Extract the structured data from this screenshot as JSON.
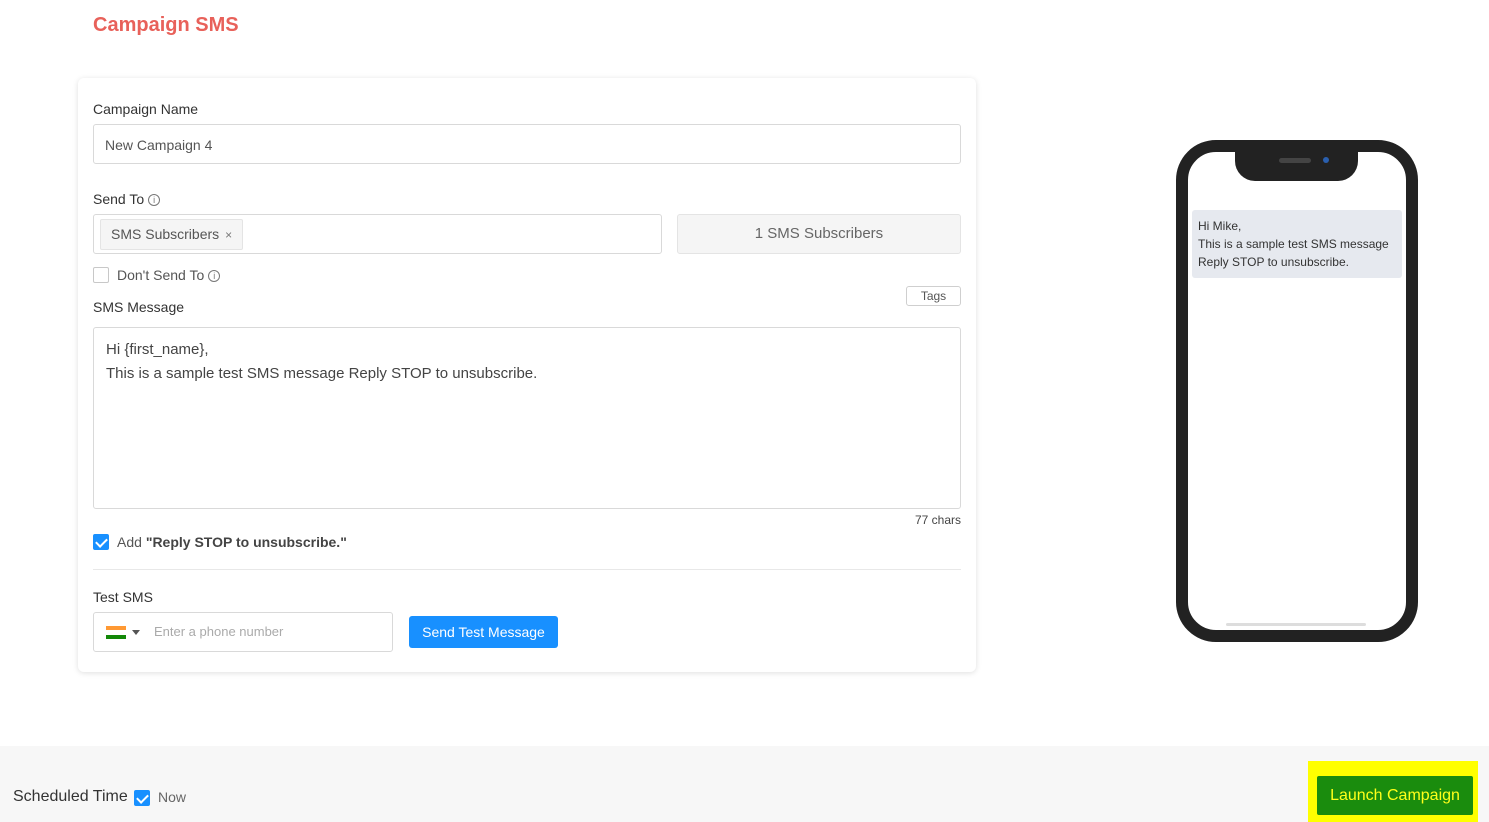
{
  "page": {
    "title": "Campaign SMS"
  },
  "form": {
    "campaign_name_label": "Campaign Name",
    "campaign_name_value": "New Campaign 4",
    "send_to_label": "Send To",
    "send_to_chip": "SMS Subscribers",
    "send_to_chip_remove": "×",
    "subscriber_count": "1 SMS Subscribers",
    "dont_send_to_label": "Don't Send To",
    "sms_message_label": "SMS Message",
    "tags_button": "Tags",
    "sms_message_line1": "Hi {first_name},",
    "sms_message_line2": "This is a sample test SMS message Reply STOP to unsubscribe.",
    "char_count": "77 chars",
    "add_reply_prefix": "Add ",
    "add_reply_bold": "\"Reply STOP to unsubscribe.\"",
    "test_sms_label": "Test SMS",
    "phone_placeholder": "Enter a phone number",
    "send_test_button": "Send Test Message",
    "info_icon_glyph": "i"
  },
  "preview": {
    "bubble_text": "Hi Mike,\nThis is a sample test SMS message\nReply STOP to unsubscribe."
  },
  "footer": {
    "scheduled_time_label": "Scheduled Time",
    "now_label": "Now",
    "launch_button": "Launch Campaign"
  },
  "colors": {
    "title": "#e8615a",
    "primary": "#1890ff",
    "launch_bg": "#1a8c0d",
    "launch_text": "#ffff1a",
    "highlight": "#ffff00"
  }
}
